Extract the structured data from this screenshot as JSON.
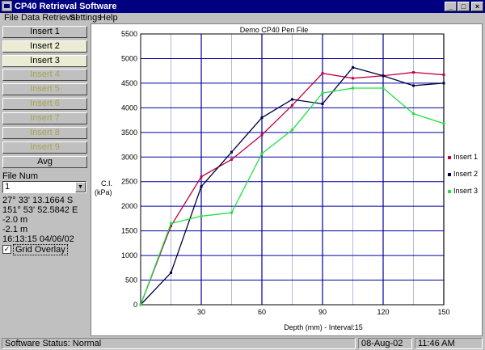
{
  "window": {
    "title": "CP40 Retrieval Software"
  },
  "menu": [
    "File",
    "Data Retrieval",
    "Settings",
    "Help"
  ],
  "sidebar": {
    "buttons": [
      {
        "label": "Insert 1",
        "state": "normal"
      },
      {
        "label": "Insert 2",
        "state": "active"
      },
      {
        "label": "Insert 3",
        "state": "active"
      },
      {
        "label": "Insert 4",
        "state": "disabled"
      },
      {
        "label": "Insert 5",
        "state": "disabled"
      },
      {
        "label": "Insert 6",
        "state": "disabled"
      },
      {
        "label": "Insert 7",
        "state": "disabled"
      },
      {
        "label": "Insert 8",
        "state": "disabled"
      },
      {
        "label": "Insert 9",
        "state": "disabled"
      },
      {
        "label": "Avg",
        "state": "normal"
      }
    ],
    "file_num_label": "File Num",
    "file_num_value": "1",
    "info": [
      "27° 33' 13.1664 S",
      "151° 53' 52.5842 E",
      "-2.0 m",
      "-2.1 m",
      "16:13:15  04/06/02"
    ],
    "grid_overlay_label": "Grid Overlay",
    "grid_overlay_checked": true
  },
  "chart_data": {
    "type": "line",
    "title": "Demo CP40 Pen File",
    "xlabel": "Depth (mm)  -  Interval:15",
    "ylabel": [
      "C.I.",
      "(kPa)"
    ],
    "xlim": [
      0,
      150
    ],
    "ylim": [
      0,
      5500
    ],
    "xticks": [
      30,
      60,
      90,
      120,
      150
    ],
    "yticks": [
      0,
      500,
      1000,
      1500,
      2000,
      2500,
      3000,
      3500,
      4000,
      4500,
      5000,
      5500
    ],
    "grid": true,
    "legend": "right",
    "series": [
      {
        "name": "Insert 1",
        "color": "#c00040",
        "x": [
          0,
          15,
          30,
          45,
          60,
          75,
          90,
          105,
          120,
          135,
          150
        ],
        "y": [
          0,
          1600,
          2600,
          2950,
          3450,
          4050,
          4700,
          4600,
          4650,
          4720,
          4670
        ]
      },
      {
        "name": "Insert 2",
        "color": "#000040",
        "x": [
          0,
          15,
          30,
          45,
          60,
          75,
          90,
          105,
          120,
          135,
          150
        ],
        "y": [
          0,
          650,
          2400,
          3100,
          3800,
          4170,
          4080,
          4820,
          4650,
          4450,
          4500
        ]
      },
      {
        "name": "Insert 3",
        "color": "#20e040",
        "x": [
          0,
          15,
          30,
          45,
          60,
          75,
          90,
          105,
          120,
          135,
          150
        ],
        "y": [
          0,
          1650,
          1800,
          1870,
          3070,
          3550,
          4300,
          4400,
          4400,
          3880,
          3680
        ]
      }
    ]
  },
  "status": {
    "text": "Software Status: Normal",
    "date": "08-Aug-02",
    "time": "11:46 AM"
  }
}
